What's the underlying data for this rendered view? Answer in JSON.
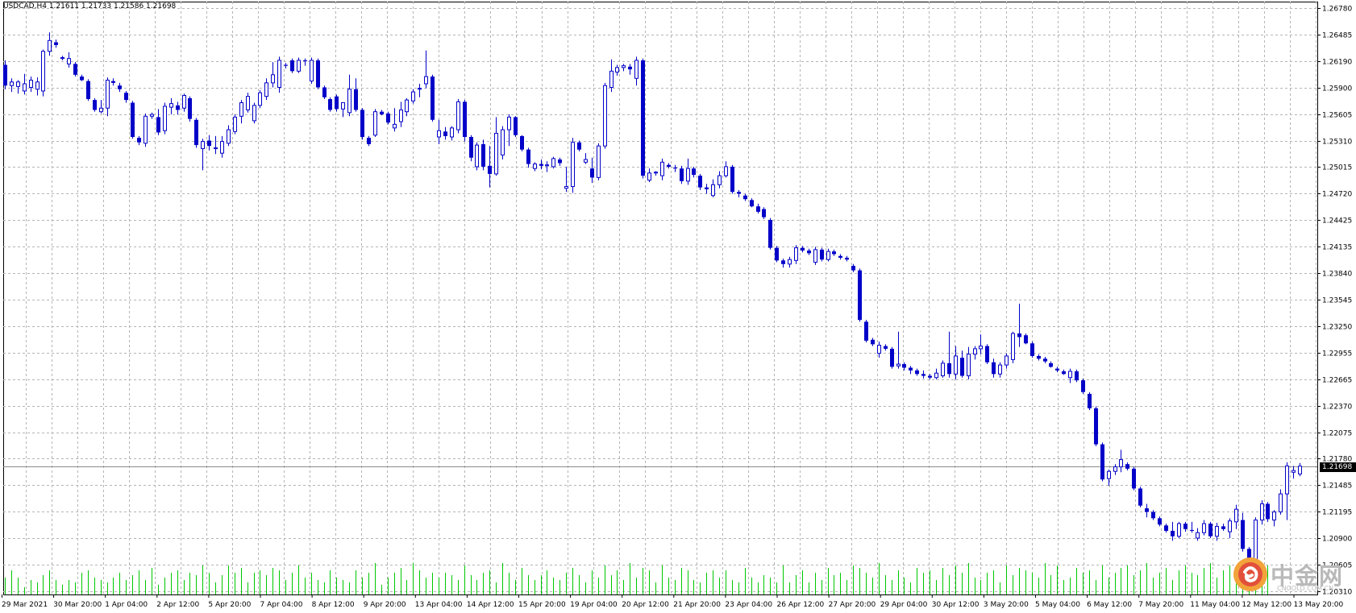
{
  "window": {
    "symbol_info": "USDCAD,H4  1.21611 1.21733 1.21586 1.21698"
  },
  "price_scale": {
    "labels": [
      "1.26780",
      "1.26485",
      "1.26190",
      "1.25900",
      "1.25605",
      "1.25310",
      "1.25015",
      "1.24720",
      "1.24425",
      "1.24135",
      "1.23840",
      "1.23545",
      "1.23250",
      "1.22955",
      "1.22665",
      "1.22370",
      "1.22075",
      "1.21780",
      "1.21485",
      "1.21195",
      "1.20900",
      "1.20605",
      "1.20310"
    ],
    "current_price": "1.21698"
  },
  "time_scale": {
    "labels": [
      "29 Mar 2021",
      "30 Mar 20:00",
      "1 Apr 04:00",
      "2 Apr 12:00",
      "5 Apr 20:00",
      "7 Apr 04:00",
      "8 Apr 12:00",
      "9 Apr 20:00",
      "13 Apr 04:00",
      "14 Apr 12:00",
      "15 Apr 20:00",
      "19 Apr 04:00",
      "20 Apr 12:00",
      "21 Apr 20:00",
      "23 Apr 04:00",
      "26 Apr 12:00",
      "27 Apr 20:00",
      "29 Apr 04:00",
      "30 Apr 12:00",
      "3 May 20:00",
      "5 May 04:00",
      "6 May 12:00",
      "7 May 20:00",
      "11 May 04:00",
      "12 May 12:00",
      "13 May 20:00"
    ]
  },
  "watermark": {
    "brand": "中金网",
    "domain": "CNGOLD.COM.CN"
  },
  "colors": {
    "background": "#ffffff",
    "grid": "#b4b4b4",
    "candle": "#0000c8",
    "volume": "#00c800",
    "text": "#000000"
  },
  "chart_data": {
    "type": "candlestick",
    "symbol": "USDCAD",
    "timeframe": "H4",
    "ylim": [
      1.2031,
      1.2688
    ],
    "ohlc_last": {
      "open": 1.21611,
      "high": 1.21733,
      "low": 1.21586,
      "close": 1.21698
    },
    "candles": [
      [
        1.2615,
        1.262,
        1.2588,
        1.2592
      ],
      [
        1.2592,
        1.26,
        1.2585,
        1.2596
      ],
      [
        1.2591,
        1.2598,
        1.2583,
        1.2596
      ],
      [
        1.2586,
        1.2605,
        1.2582,
        1.2594
      ],
      [
        1.259,
        1.2602,
        1.2585,
        1.2598
      ],
      [
        1.2588,
        1.2601,
        1.2581,
        1.2596
      ],
      [
        1.2586,
        1.2632,
        1.258,
        1.263
      ],
      [
        1.263,
        1.2651,
        1.2625,
        1.2642
      ],
      [
        1.264,
        1.2643,
        1.2634,
        1.2637
      ],
      [
        1.2622,
        1.2625,
        1.262,
        1.2623
      ],
      [
        1.2616,
        1.2629,
        1.2612,
        1.2622
      ],
      [
        1.2616,
        1.2618,
        1.2602,
        1.2604
      ],
      [
        1.2602,
        1.2604,
        1.2597,
        1.2598
      ],
      [
        1.2597,
        1.2599,
        1.2575,
        1.2577
      ],
      [
        1.2576,
        1.2578,
        1.2563,
        1.2565
      ],
      [
        1.2563,
        1.2576,
        1.2561,
        1.2567
      ],
      [
        1.2567,
        1.2601,
        1.2558,
        1.2598
      ],
      [
        1.2597,
        1.26,
        1.2592,
        1.2595
      ],
      [
        1.2592,
        1.2595,
        1.2585,
        1.2588
      ],
      [
        1.2584,
        1.2586,
        1.2573,
        1.2576
      ],
      [
        1.2573,
        1.2575,
        1.2533,
        1.2535
      ],
      [
        1.2534,
        1.2536,
        1.2526,
        1.2529
      ],
      [
        1.2528,
        1.2561,
        1.2524,
        1.2558
      ],
      [
        1.2558,
        1.2562,
        1.2555,
        1.256
      ],
      [
        1.2557,
        1.2566,
        1.2537,
        1.254
      ],
      [
        1.2542,
        1.2573,
        1.2538,
        1.2569
      ],
      [
        1.2568,
        1.2578,
        1.256,
        1.2572
      ],
      [
        1.257,
        1.2574,
        1.256,
        1.2565
      ],
      [
        1.2567,
        1.2583,
        1.2563,
        1.2581
      ],
      [
        1.2578,
        1.258,
        1.2552,
        1.2555
      ],
      [
        1.2554,
        1.2556,
        1.2523,
        1.2526
      ],
      [
        1.2522,
        1.2533,
        1.2498,
        1.253
      ],
      [
        1.2531,
        1.2537,
        1.252,
        1.2525
      ],
      [
        1.2522,
        1.2536,
        1.2516,
        1.2523
      ],
      [
        1.2517,
        1.2536,
        1.2512,
        1.253
      ],
      [
        1.2528,
        1.2548,
        1.2525,
        1.2543
      ],
      [
        1.2541,
        1.256,
        1.2538,
        1.2557
      ],
      [
        1.2558,
        1.2576,
        1.255,
        1.2573
      ],
      [
        1.2565,
        1.2584,
        1.2562,
        1.258
      ],
      [
        1.2553,
        1.2573,
        1.255,
        1.257
      ],
      [
        1.257,
        1.2587,
        1.2567,
        1.2584
      ],
      [
        1.258,
        1.26,
        1.2576,
        1.2595
      ],
      [
        1.2595,
        1.2618,
        1.259,
        1.2604
      ],
      [
        1.259,
        1.2624,
        1.2584,
        1.262
      ],
      [
        1.2615,
        1.2617,
        1.2611,
        1.2614
      ],
      [
        1.262,
        1.2622,
        1.2606,
        1.2608
      ],
      [
        1.2608,
        1.2623,
        1.2606,
        1.262
      ],
      [
        1.262,
        1.2622,
        1.2614,
        1.2619
      ],
      [
        1.2597,
        1.2623,
        1.2594,
        1.262
      ],
      [
        1.262,
        1.2622,
        1.2588,
        1.259
      ],
      [
        1.259,
        1.2592,
        1.2577,
        1.2579
      ],
      [
        1.2577,
        1.2579,
        1.2563,
        1.2565
      ],
      [
        1.258,
        1.2582,
        1.2563,
        1.2566
      ],
      [
        1.2566,
        1.2573,
        1.2557,
        1.2573
      ],
      [
        1.2562,
        1.2604,
        1.2558,
        1.2588
      ],
      [
        1.2588,
        1.26,
        1.2563,
        1.2565
      ],
      [
        1.2565,
        1.2567,
        1.2532,
        1.2535
      ],
      [
        1.2534,
        1.2536,
        1.2525,
        1.2527
      ],
      [
        1.2537,
        1.2566,
        1.2535,
        1.2563
      ],
      [
        1.2563,
        1.2565,
        1.2559,
        1.256
      ],
      [
        1.2561,
        1.2563,
        1.2549,
        1.2551
      ],
      [
        1.2545,
        1.2567,
        1.2541,
        1.2549
      ],
      [
        1.2552,
        1.2574,
        1.2546,
        1.2565
      ],
      [
        1.2563,
        1.2578,
        1.2558,
        1.2576
      ],
      [
        1.2575,
        1.2588,
        1.2572,
        1.2585
      ],
      [
        1.2588,
        1.2594,
        1.2579,
        1.2589
      ],
      [
        1.2594,
        1.2631,
        1.2589,
        1.2602
      ],
      [
        1.2602,
        1.2604,
        1.2552,
        1.2554
      ],
      [
        1.2535,
        1.2554,
        1.2527,
        1.2542
      ],
      [
        1.2541,
        1.2546,
        1.2532,
        1.2536
      ],
      [
        1.2535,
        1.2547,
        1.2531,
        1.2545
      ],
      [
        1.2543,
        1.2577,
        1.2539,
        1.2574
      ],
      [
        1.2574,
        1.2576,
        1.253,
        1.2535
      ],
      [
        1.2535,
        1.2537,
        1.2508,
        1.2512
      ],
      [
        1.2502,
        1.2529,
        1.2498,
        1.2526
      ],
      [
        1.2527,
        1.2532,
        1.2498,
        1.2502
      ],
      [
        1.2503,
        1.2525,
        1.2479,
        1.2494
      ],
      [
        1.2494,
        1.2557,
        1.2492,
        1.2539
      ],
      [
        1.2515,
        1.2547,
        1.251,
        1.2543
      ],
      [
        1.2543,
        1.256,
        1.2525,
        1.2557
      ],
      [
        1.2557,
        1.2558,
        1.2535,
        1.2537
      ],
      [
        1.2536,
        1.2537,
        1.2519,
        1.2521
      ],
      [
        1.2521,
        1.2523,
        1.2501,
        1.2505
      ],
      [
        1.25,
        1.2507,
        1.2497,
        1.2505
      ],
      [
        1.2505,
        1.251,
        1.2499,
        1.2503
      ],
      [
        1.2503,
        1.2508,
        1.2496,
        1.2504
      ],
      [
        1.2502,
        1.2513,
        1.25,
        1.2511
      ],
      [
        1.251,
        1.2512,
        1.2503,
        1.2506
      ],
      [
        1.2478,
        1.2502,
        1.2474,
        1.248
      ],
      [
        1.248,
        1.2534,
        1.2473,
        1.2529
      ],
      [
        1.2529,
        1.2531,
        1.2519,
        1.2521
      ],
      [
        1.2507,
        1.2517,
        1.2505,
        1.251
      ],
      [
        1.25,
        1.2512,
        1.2484,
        1.249
      ],
      [
        1.249,
        1.2528,
        1.2487,
        1.2525
      ],
      [
        1.2525,
        1.2595,
        1.2522,
        1.2592
      ],
      [
        1.259,
        1.2621,
        1.2585,
        1.2608
      ],
      [
        1.2607,
        1.2615,
        1.2603,
        1.2612
      ],
      [
        1.2612,
        1.2616,
        1.2608,
        1.2614
      ],
      [
        1.2613,
        1.2616,
        1.2604,
        1.261
      ],
      [
        1.26,
        1.2624,
        1.2592,
        1.262
      ],
      [
        1.262,
        1.2622,
        1.2489,
        1.2492
      ],
      [
        1.2487,
        1.25,
        1.2485,
        1.2495
      ],
      [
        1.2495,
        1.2497,
        1.2492,
        1.2496
      ],
      [
        1.2492,
        1.2511,
        1.2487,
        1.2507
      ],
      [
        1.2504,
        1.2506,
        1.25,
        1.2502
      ],
      [
        1.2501,
        1.2504,
        1.2496,
        1.25
      ],
      [
        1.25,
        1.2503,
        1.2483,
        1.2486
      ],
      [
        1.2486,
        1.2511,
        1.2482,
        1.25
      ],
      [
        1.25,
        1.2502,
        1.249,
        1.2493
      ],
      [
        1.2492,
        1.2494,
        1.2476,
        1.2479
      ],
      [
        1.2479,
        1.2483,
        1.2472,
        1.2477
      ],
      [
        1.247,
        1.2488,
        1.2468,
        1.2482
      ],
      [
        1.2482,
        1.2497,
        1.2478,
        1.2492
      ],
      [
        1.2492,
        1.2508,
        1.249,
        1.2502
      ],
      [
        1.2502,
        1.2504,
        1.2472,
        1.2474
      ],
      [
        1.2474,
        1.2476,
        1.2468,
        1.2472
      ],
      [
        1.247,
        1.2472,
        1.2464,
        1.2466
      ],
      [
        1.2465,
        1.2467,
        1.2457,
        1.2458
      ],
      [
        1.2458,
        1.2461,
        1.245,
        1.2452
      ],
      [
        1.2455,
        1.2457,
        1.2444,
        1.2446
      ],
      [
        1.2443,
        1.2445,
        1.241,
        1.2412
      ],
      [
        1.2412,
        1.2414,
        1.2396,
        1.2398
      ],
      [
        1.2398,
        1.24,
        1.239,
        1.2394
      ],
      [
        1.2394,
        1.2402,
        1.239,
        1.2399
      ],
      [
        1.2398,
        1.2415,
        1.2394,
        1.2412
      ],
      [
        1.2412,
        1.2414,
        1.2407,
        1.2409
      ],
      [
        1.2409,
        1.2411,
        1.2404,
        1.2406
      ],
      [
        1.2396,
        1.2413,
        1.2393,
        1.241
      ],
      [
        1.241,
        1.2412,
        1.2397,
        1.2399
      ],
      [
        1.2399,
        1.2411,
        1.2397,
        1.2408
      ],
      [
        1.2408,
        1.241,
        1.2403,
        1.2405
      ],
      [
        1.2403,
        1.2405,
        1.2399,
        1.2401
      ],
      [
        1.2401,
        1.2403,
        1.2397,
        1.2399
      ],
      [
        1.2392,
        1.2394,
        1.2385,
        1.2387
      ],
      [
        1.2387,
        1.2389,
        1.233,
        1.2332
      ],
      [
        1.233,
        1.2332,
        1.2307,
        1.2309
      ],
      [
        1.231,
        1.2312,
        1.2303,
        1.2305
      ],
      [
        1.2295,
        1.2308,
        1.229,
        1.2304
      ],
      [
        1.2303,
        1.2305,
        1.2298,
        1.23
      ],
      [
        1.23,
        1.2302,
        1.2278,
        1.228
      ],
      [
        1.2281,
        1.2319,
        1.2278,
        1.2283
      ],
      [
        1.2283,
        1.2285,
        1.2276,
        1.2279
      ],
      [
        1.2279,
        1.2281,
        1.2272,
        1.2276
      ],
      [
        1.2276,
        1.2278,
        1.227,
        1.2272
      ],
      [
        1.2272,
        1.2276,
        1.2267,
        1.227
      ],
      [
        1.227,
        1.2272,
        1.2266,
        1.2268
      ],
      [
        1.2268,
        1.2278,
        1.2266,
        1.2273
      ],
      [
        1.227,
        1.2287,
        1.2268,
        1.2284
      ],
      [
        1.2284,
        1.2319,
        1.2268,
        1.2272
      ],
      [
        1.2272,
        1.2303,
        1.2266,
        1.2292
      ],
      [
        1.229,
        1.2298,
        1.2268,
        1.227
      ],
      [
        1.227,
        1.2302,
        1.2266,
        1.2294
      ],
      [
        1.2294,
        1.2303,
        1.2288,
        1.23
      ],
      [
        1.23,
        1.2316,
        1.2294,
        1.2303
      ],
      [
        1.2303,
        1.2305,
        1.2283,
        1.2285
      ],
      [
        1.2285,
        1.2289,
        1.2268,
        1.2272
      ],
      [
        1.2272,
        1.2285,
        1.2268,
        1.2282
      ],
      [
        1.2282,
        1.2295,
        1.2278,
        1.2292
      ],
      [
        1.2288,
        1.2319,
        1.2284,
        1.2317
      ],
      [
        1.2317,
        1.235,
        1.2302,
        1.2313
      ],
      [
        1.2315,
        1.2317,
        1.2305,
        1.2306
      ],
      [
        1.2306,
        1.2308,
        1.229,
        1.2292
      ],
      [
        1.2292,
        1.2294,
        1.2287,
        1.2289
      ],
      [
        1.2289,
        1.2291,
        1.2284,
        1.2286
      ],
      [
        1.2284,
        1.2286,
        1.2279,
        1.228
      ],
      [
        1.2278,
        1.228,
        1.2274,
        1.2276
      ],
      [
        1.2275,
        1.2277,
        1.2271,
        1.2272
      ],
      [
        1.2268,
        1.2278,
        1.2262,
        1.2275
      ],
      [
        1.2275,
        1.2277,
        1.2263,
        1.2265
      ],
      [
        1.2265,
        1.2267,
        1.225,
        1.2252
      ],
      [
        1.225,
        1.2252,
        1.2232,
        1.2234
      ],
      [
        1.2234,
        1.2236,
        1.2192,
        1.2194
      ],
      [
        1.2194,
        1.2196,
        1.2153,
        1.2155
      ],
      [
        1.2156,
        1.2166,
        1.2148,
        1.2164
      ],
      [
        1.2164,
        1.2172,
        1.216,
        1.2169
      ],
      [
        1.2169,
        1.2188,
        1.2163,
        1.2177
      ],
      [
        1.2172,
        1.2174,
        1.2165,
        1.2167
      ],
      [
        1.2167,
        1.2169,
        1.2143,
        1.2145
      ],
      [
        1.2145,
        1.2147,
        1.2124,
        1.2126
      ],
      [
        1.2123,
        1.2128,
        1.2113,
        1.2119
      ],
      [
        1.2119,
        1.2121,
        1.211,
        1.2112
      ],
      [
        1.2112,
        1.2114,
        1.2103,
        1.2105
      ],
      [
        1.2104,
        1.2106,
        1.2096,
        1.2098
      ],
      [
        1.2098,
        1.2108,
        1.2087,
        1.2092
      ],
      [
        1.2092,
        1.2108,
        1.209,
        1.2106
      ],
      [
        1.2106,
        1.2108,
        1.2097,
        1.21
      ],
      [
        1.2099,
        1.2108,
        1.2096,
        1.2098
      ],
      [
        1.209,
        1.2101,
        1.2087,
        1.2096
      ],
      [
        1.2096,
        1.211,
        1.2093,
        1.2106
      ],
      [
        1.2106,
        1.2108,
        1.209,
        1.2092
      ],
      [
        1.2092,
        1.2107,
        1.2087,
        1.2103
      ],
      [
        1.2103,
        1.2106,
        1.2098,
        1.21
      ],
      [
        1.2097,
        1.2112,
        1.209,
        1.2109
      ],
      [
        1.2108,
        1.2127,
        1.21,
        1.2122
      ],
      [
        1.211,
        1.2118,
        1.2075,
        1.2078
      ],
      [
        1.2078,
        1.208,
        1.206,
        1.2062
      ],
      [
        1.2063,
        1.2113,
        1.2035,
        1.211
      ],
      [
        1.211,
        1.2132,
        1.2105,
        1.2128
      ],
      [
        1.2128,
        1.213,
        1.2108,
        1.2111
      ],
      [
        1.211,
        1.2121,
        1.2103,
        1.2119
      ],
      [
        1.2119,
        1.2144,
        1.2116,
        1.2139
      ],
      [
        1.2139,
        1.2174,
        1.211,
        1.217
      ],
      [
        1.2163,
        1.217,
        1.2156,
        1.2165
      ],
      [
        1.21611,
        1.21733,
        1.21586,
        1.21698
      ]
    ],
    "volume": [
      7,
      10,
      7,
      3,
      6,
      5,
      8,
      10,
      6,
      4,
      6,
      5,
      9,
      10,
      7,
      6,
      5,
      7,
      9,
      6,
      8,
      10,
      6,
      11,
      4,
      7,
      9,
      10,
      6,
      9,
      8,
      12,
      9,
      5,
      8,
      12,
      9,
      11,
      5,
      9,
      10,
      8,
      11,
      10,
      6,
      9,
      12,
      7,
      9,
      6,
      5,
      10,
      7,
      6,
      5,
      10,
      7,
      9,
      13,
      4,
      7,
      9,
      11,
      6,
      13,
      10,
      7,
      9,
      7,
      9,
      8,
      6,
      12,
      8,
      6,
      9,
      10,
      5,
      13,
      9,
      6,
      11,
      8,
      6,
      8,
      10,
      7,
      6,
      9,
      11,
      8,
      5,
      10,
      7,
      12,
      8,
      10,
      6,
      13,
      7,
      11,
      10,
      5,
      12,
      7,
      6,
      11,
      10,
      6,
      5,
      9,
      10,
      7,
      10,
      6,
      5,
      11,
      7,
      5,
      8,
      7,
      5,
      12,
      5,
      8,
      10,
      5,
      9,
      6,
      11,
      8,
      9,
      6,
      12,
      11,
      9,
      7,
      13,
      8,
      6,
      10,
      7,
      5,
      11,
      9,
      10,
      6,
      11,
      8,
      12,
      9,
      13,
      7,
      6,
      9,
      10,
      5,
      12,
      8,
      11,
      10,
      9,
      7,
      13,
      8,
      12,
      6,
      7,
      11,
      9,
      10,
      6,
      12,
      7,
      9,
      11,
      12,
      8,
      10,
      13,
      7,
      9,
      11,
      6,
      10,
      12,
      9,
      8,
      11,
      13,
      7,
      10,
      12,
      8,
      9,
      11,
      13,
      7,
      12
    ]
  }
}
